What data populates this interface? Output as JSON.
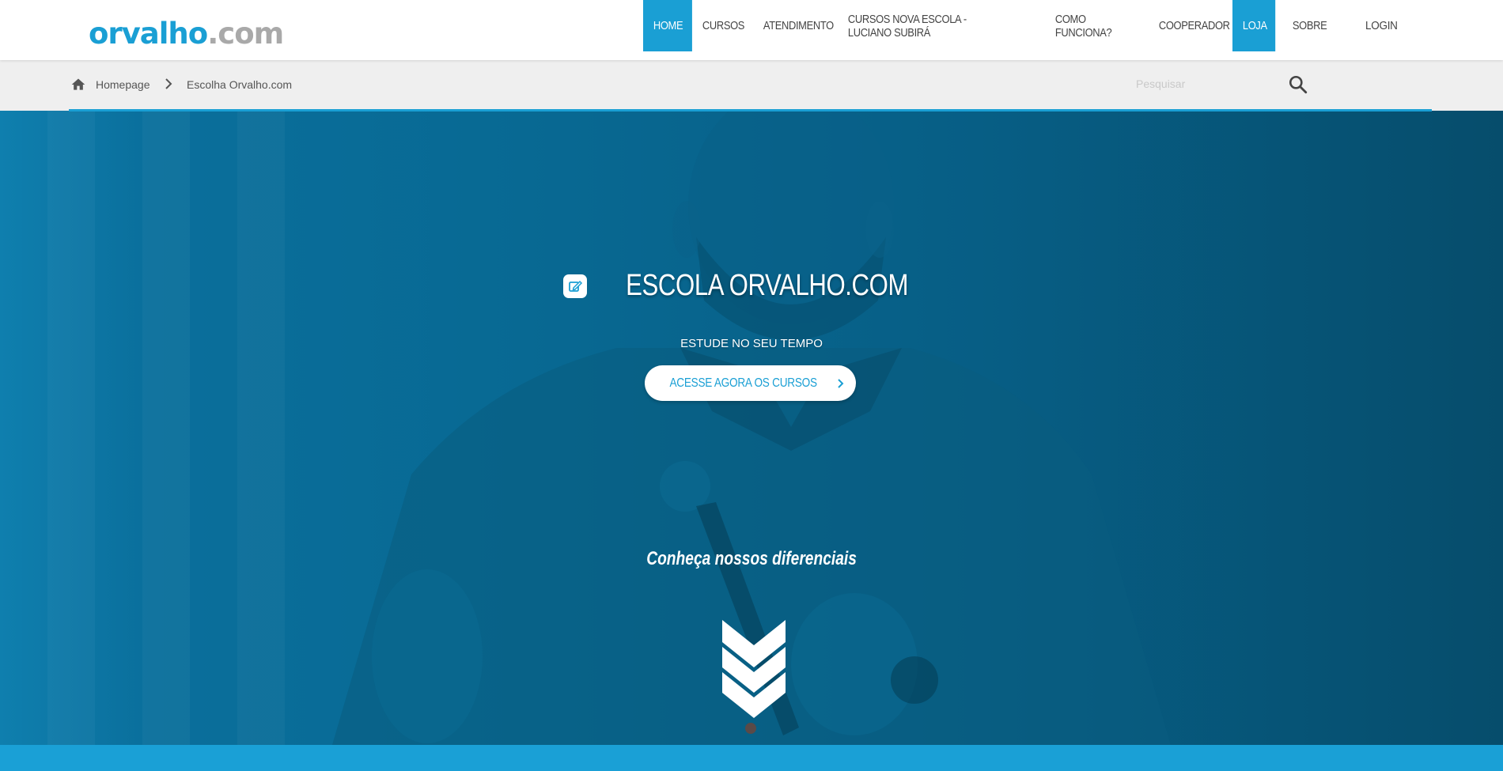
{
  "header": {
    "logo_part1": "orvalho",
    "logo_part2": ".com",
    "nav": [
      {
        "label": "HOME",
        "active": true
      },
      {
        "label": "CURSOS",
        "active": false
      },
      {
        "label": "ATENDIMENTO",
        "active": false
      },
      {
        "label": "CURSOS NOVA ESCOLA - LUCIANO SUBIRÁ",
        "active": false
      },
      {
        "label": "COMO FUNCIONA?",
        "active": false
      },
      {
        "label": "COOPERADOR",
        "active": false
      },
      {
        "label": "LOJA",
        "active": true
      },
      {
        "label": "SOBRE",
        "active": false
      }
    ],
    "login_label": "LOGIN"
  },
  "breadcrumb": {
    "home_label": "Homepage",
    "current_label": "Escolha Orvalho.com"
  },
  "search": {
    "placeholder": "Pesquisar",
    "value": ""
  },
  "hero": {
    "title": "ESCOLA ORVALHO.COM",
    "subtitle": "ESTUDE NO SEU TEMPO",
    "cta_label": "ACESSE AGORA OS CURSOS",
    "diff_label": "Conheça nossos diferenciais"
  },
  "icons": {
    "home": "home-icon",
    "breadcrumb_separator": "chevron-right-icon",
    "search": "search-icon",
    "title": "edit-icon",
    "cta": "chevron-right-icon",
    "scroll": "chevrons-down-icon"
  },
  "colors": {
    "accent": "#1a9fd4",
    "hero_overlay": "#086993",
    "breadcrumb_bg": "#efefef",
    "text_dark": "#444444",
    "logo_gray": "#a9a9a9"
  }
}
